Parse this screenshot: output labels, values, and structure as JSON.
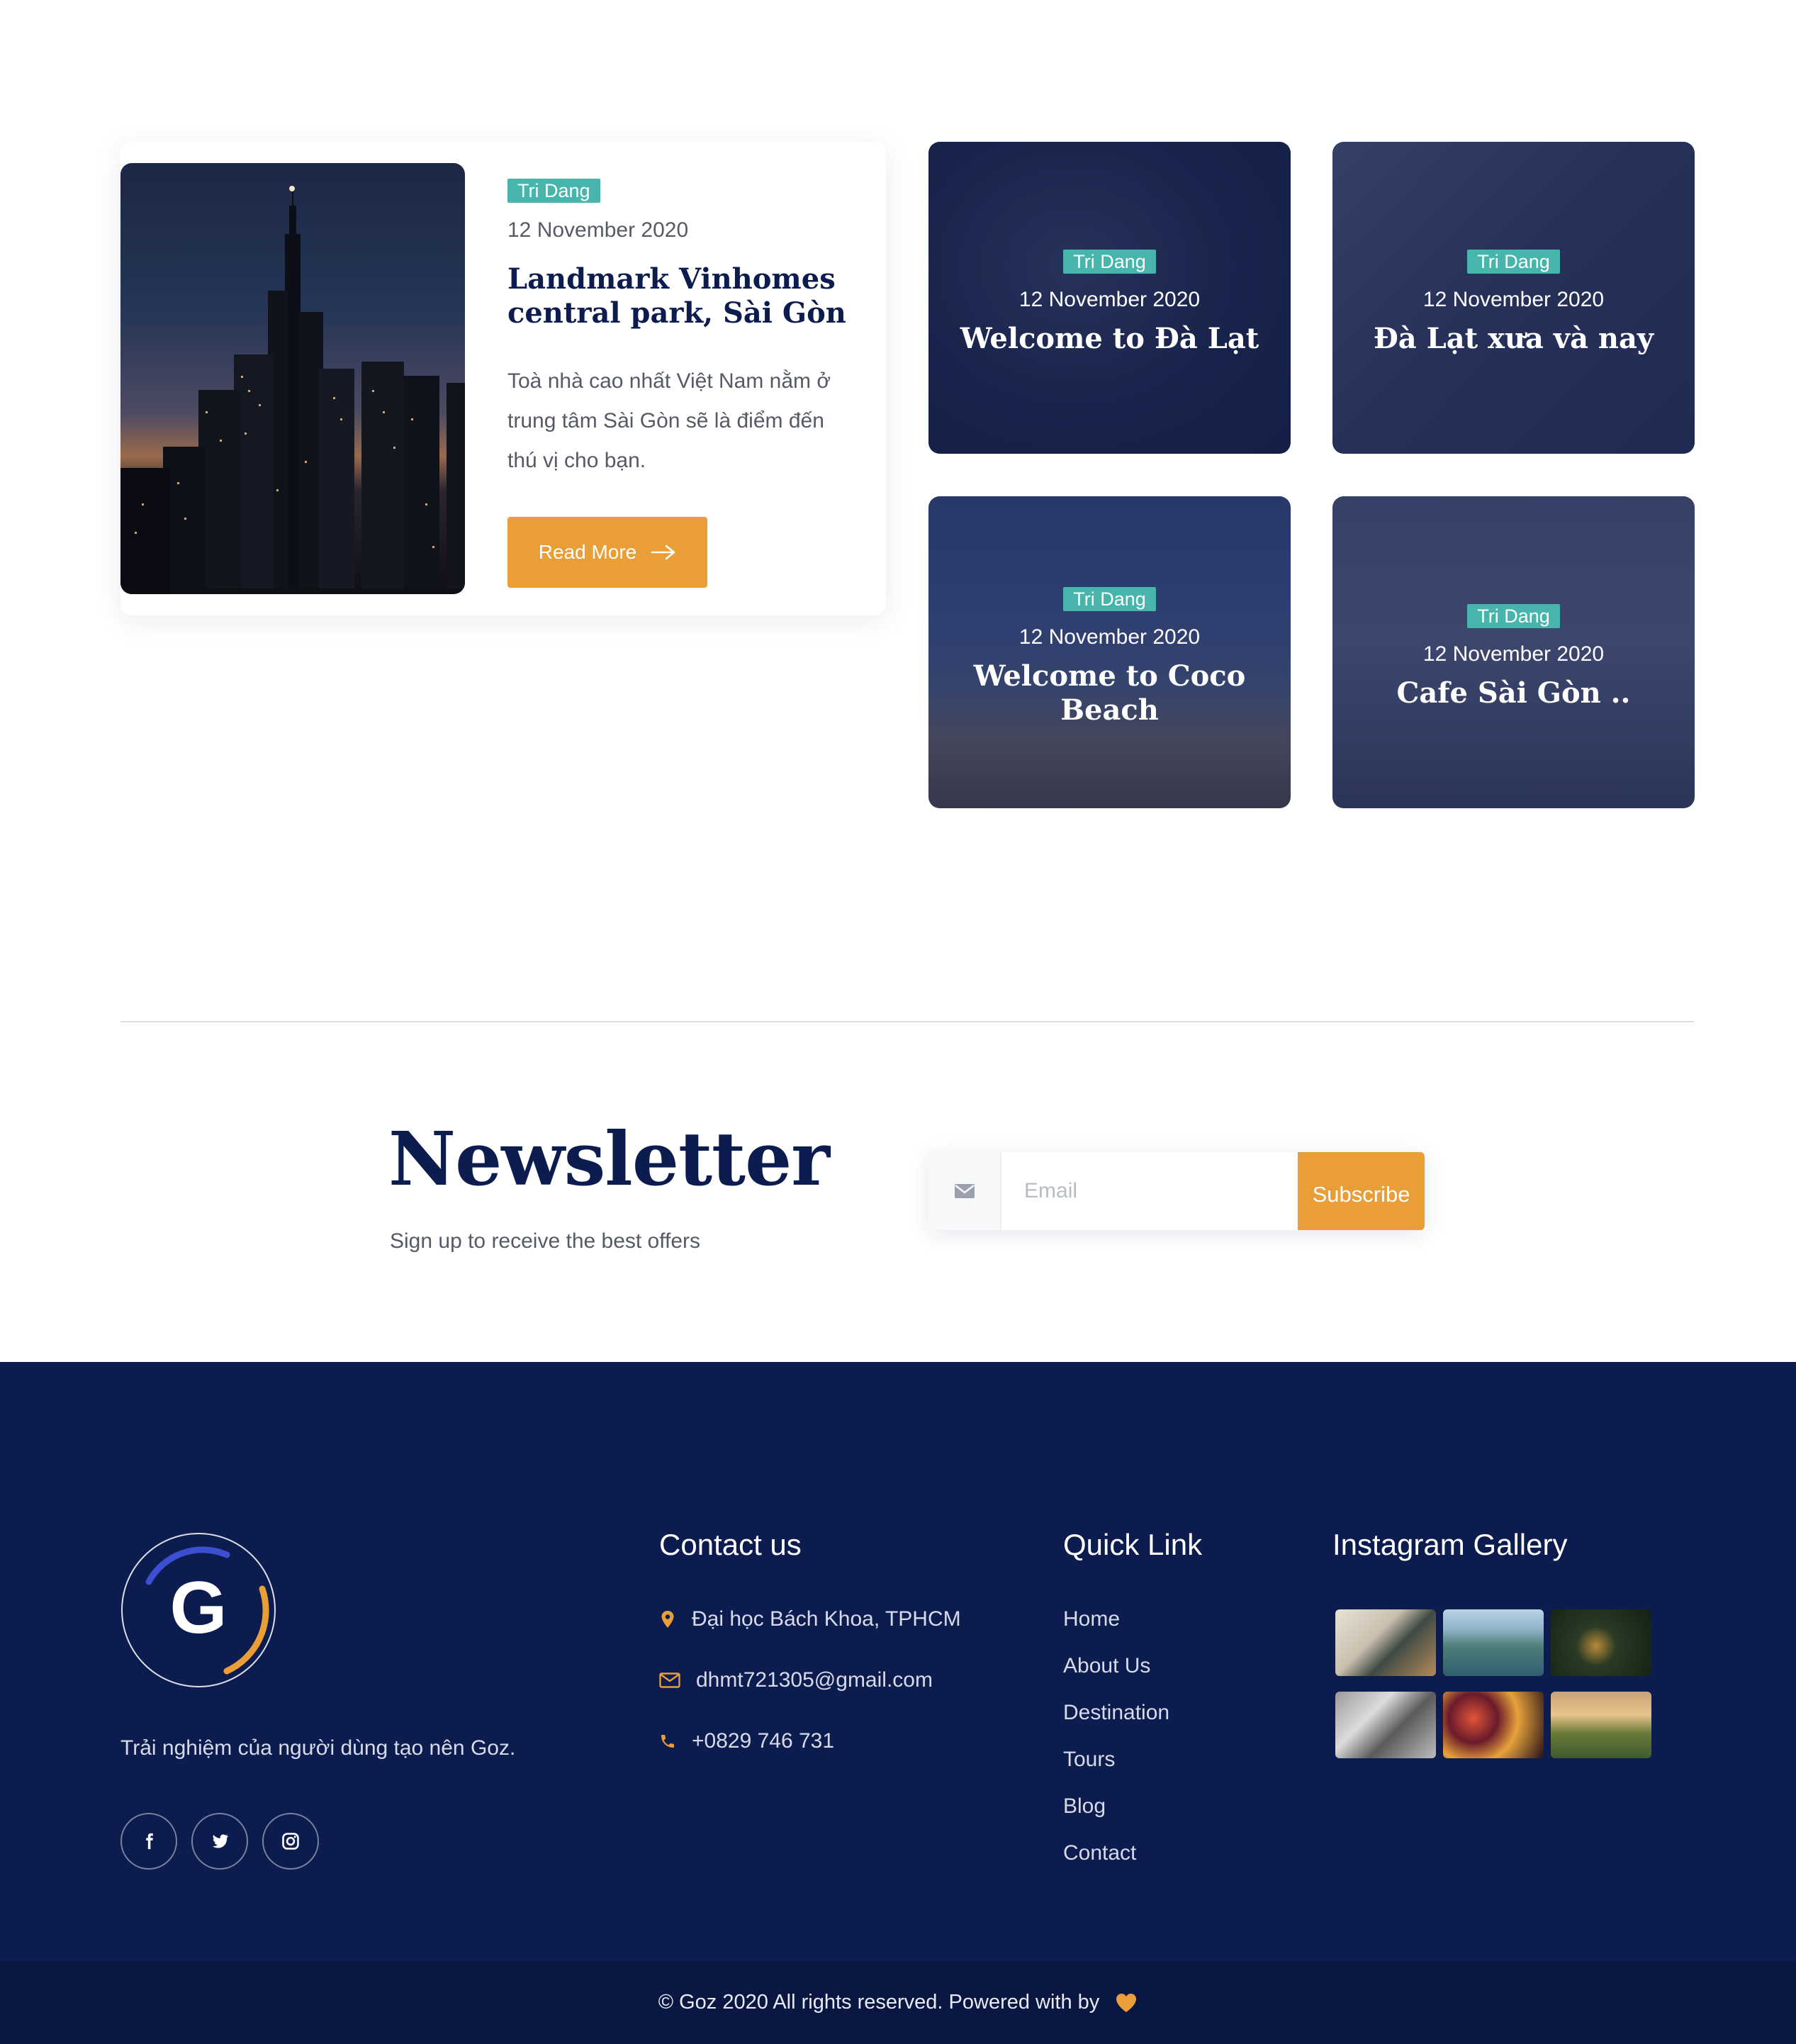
{
  "featured": {
    "author": "Tri Dang",
    "date": "12 November 2020",
    "title": "Landmark Vinhomes central park, Sài Gòn",
    "excerpt": "Toà nhà cao nhất Việt Nam nằm ở trung tâm Sài Gòn sẽ là điểm đến thú vị cho bạn.",
    "button_label": "Read More"
  },
  "cards": [
    {
      "author": "Tri Dang",
      "date": "12 November 2020",
      "title": "Welcome to Đà Lạt"
    },
    {
      "author": "Tri Dang",
      "date": "12 November 2020",
      "title": "Đà Lạt xưa và nay"
    },
    {
      "author": "Tri Dang",
      "date": "12 November 2020",
      "title": "Welcome to Coco Beach"
    },
    {
      "author": "Tri Dang",
      "date": "12 November 2020",
      "title": "Cafe Sài Gòn .."
    }
  ],
  "newsletter": {
    "title": "Newsletter",
    "subtitle": "Sign up to receive the best offers",
    "email_placeholder": "Email",
    "email_value": "",
    "button_label": "Subscribe"
  },
  "footer": {
    "logo_letter": "G",
    "description": "Trải nghiệm của người dùng tạo nên Goz.",
    "contact_title": "Contact us",
    "contact": {
      "address": "Đại học Bách Khoa, TPHCM",
      "email": "dhmt721305@gmail.com",
      "phone": "+0829 746 731"
    },
    "quick_link_title": "Quick Link",
    "quick_links": [
      "Home",
      "About Us",
      "Destination",
      "Tours",
      "Blog",
      "Contact"
    ],
    "instagram_title": "Instagram Gallery",
    "social_icons": [
      "facebook-icon",
      "twitter-icon",
      "instagram-icon"
    ],
    "copyright": "© Goz 2020 All rights reserved. Powered with by"
  },
  "colors": {
    "navy": "#0c1c4f",
    "accent_orange": "#e99e38",
    "tag_teal": "#48b5ad",
    "footer_bottom": "#0a1742"
  }
}
